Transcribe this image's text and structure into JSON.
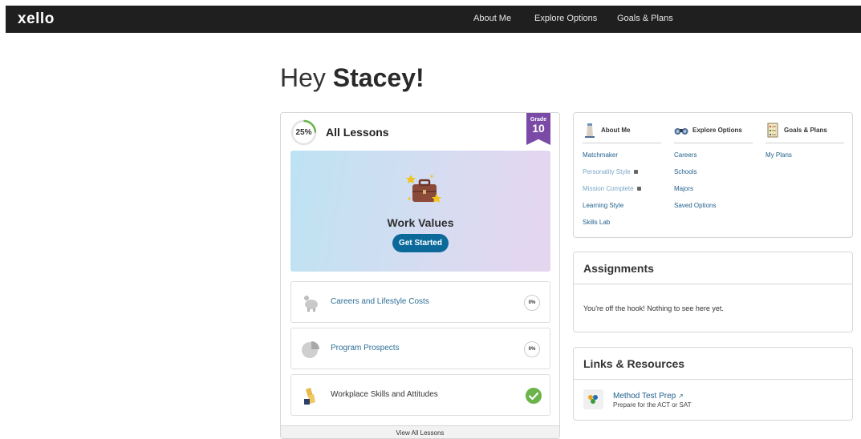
{
  "header": {
    "logo": "xello",
    "nav": [
      "About Me",
      "Explore Options",
      "Goals & Plans"
    ]
  },
  "greeting": {
    "prefix": "Hey ",
    "name": "Stacey!"
  },
  "lessons": {
    "progress": "25%",
    "progress_fraction": 0.25,
    "title": "All Lessons",
    "grade_label": "Grade",
    "grade_value": "10",
    "featured": {
      "title": "Work Values",
      "button": "Get Started"
    },
    "items": [
      {
        "label": "Careers and Lifestyle Costs",
        "status": "0%",
        "icon": "piggy-bank-icon"
      },
      {
        "label": "Program Prospects",
        "status": "0%",
        "icon": "pie-chart-icon"
      },
      {
        "label": "Workplace Skills and Attitudes",
        "status": "complete",
        "icon": "hands-icon"
      }
    ],
    "view_all": "View All Lessons"
  },
  "quicknav": {
    "columns": [
      {
        "title": "About Me",
        "icon": "lighthouse-icon",
        "links": [
          {
            "label": "Matchmaker",
            "locked": false
          },
          {
            "label": "Personality Style",
            "locked": true
          },
          {
            "label": "Mission Complete",
            "locked": true
          },
          {
            "label": "Learning Style",
            "locked": false
          },
          {
            "label": "Skills Lab",
            "locked": false
          }
        ]
      },
      {
        "title": "Explore Options",
        "icon": "binoculars-icon",
        "links": [
          {
            "label": "Careers",
            "locked": false
          },
          {
            "label": "Schools",
            "locked": false
          },
          {
            "label": "Majors",
            "locked": false
          },
          {
            "label": "Saved Options",
            "locked": false
          }
        ]
      },
      {
        "title": "Goals & Plans",
        "icon": "checklist-icon",
        "links": [
          {
            "label": "My Plans",
            "locked": false
          }
        ]
      }
    ]
  },
  "assignments": {
    "title": "Assignments",
    "empty": "You're off the hook! Nothing to see here yet."
  },
  "resources": {
    "title": "Links & Resources",
    "items": [
      {
        "title": "Method Test Prep",
        "subtitle": "Prepare for the ACT or SAT"
      }
    ]
  },
  "colors": {
    "accent": "#0c6a9b",
    "grade_badge": "#7a4aa6",
    "success": "#6bb34a",
    "link": "#1f5f8b",
    "topbar": "#1f1f1f"
  }
}
